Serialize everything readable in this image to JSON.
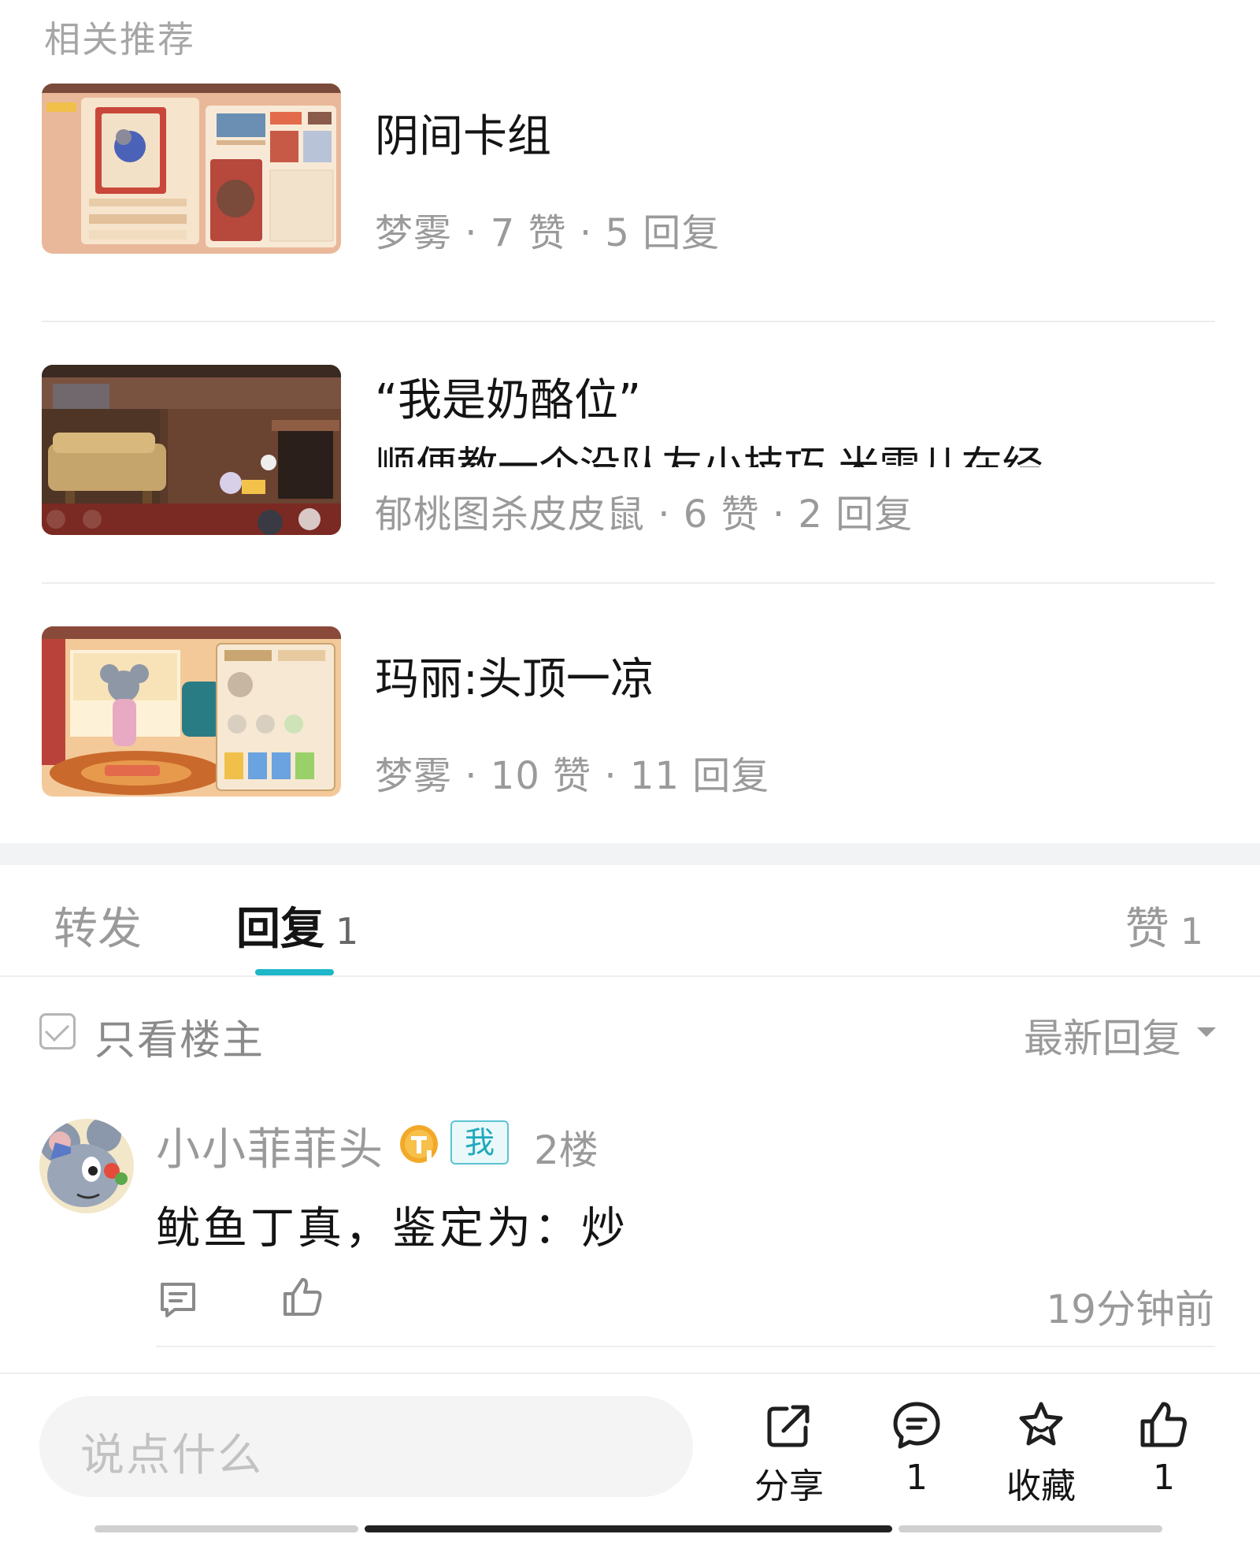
{
  "section_title": "相关推荐",
  "recommendations": [
    {
      "title": "阴间卡组",
      "subtitle": "",
      "author": "梦雾",
      "likes": "7 赞",
      "replies": "5 回复"
    },
    {
      "title": "“我是奶酪位”",
      "subtitle": "顺便教一个没队友小技巧 米雪儿在经",
      "author": "郁桃图杀皮皮鼠",
      "likes": "6 赞",
      "replies": "2 回复"
    },
    {
      "title": "玛丽:头顶一凉",
      "subtitle": "",
      "author": "梦雾",
      "likes": "10 赞",
      "replies": "11 回复"
    }
  ],
  "meta_separator": " · ",
  "tabs": {
    "forward": {
      "label": "转发"
    },
    "reply": {
      "label": "回复",
      "count": "1"
    },
    "like": {
      "label": "赞",
      "count": "1"
    }
  },
  "filter": {
    "only_op_label": "只看楼主",
    "sort_label": "最新回复"
  },
  "comment": {
    "username": "小小菲菲头",
    "me_badge": "我",
    "floor": "2楼",
    "text": "鱿鱼丁真，鉴定为：炒",
    "time": "19分钟前"
  },
  "bottom_bar": {
    "input_placeholder": "说点什么",
    "share_label": "分享",
    "comment_count": "1",
    "favorite_label": "收藏",
    "like_count": "1"
  },
  "colors": {
    "accent": "#1fb6c9",
    "muted_text": "#9a9a9a",
    "primary_text": "#141414",
    "band": "#f2f3f5"
  }
}
